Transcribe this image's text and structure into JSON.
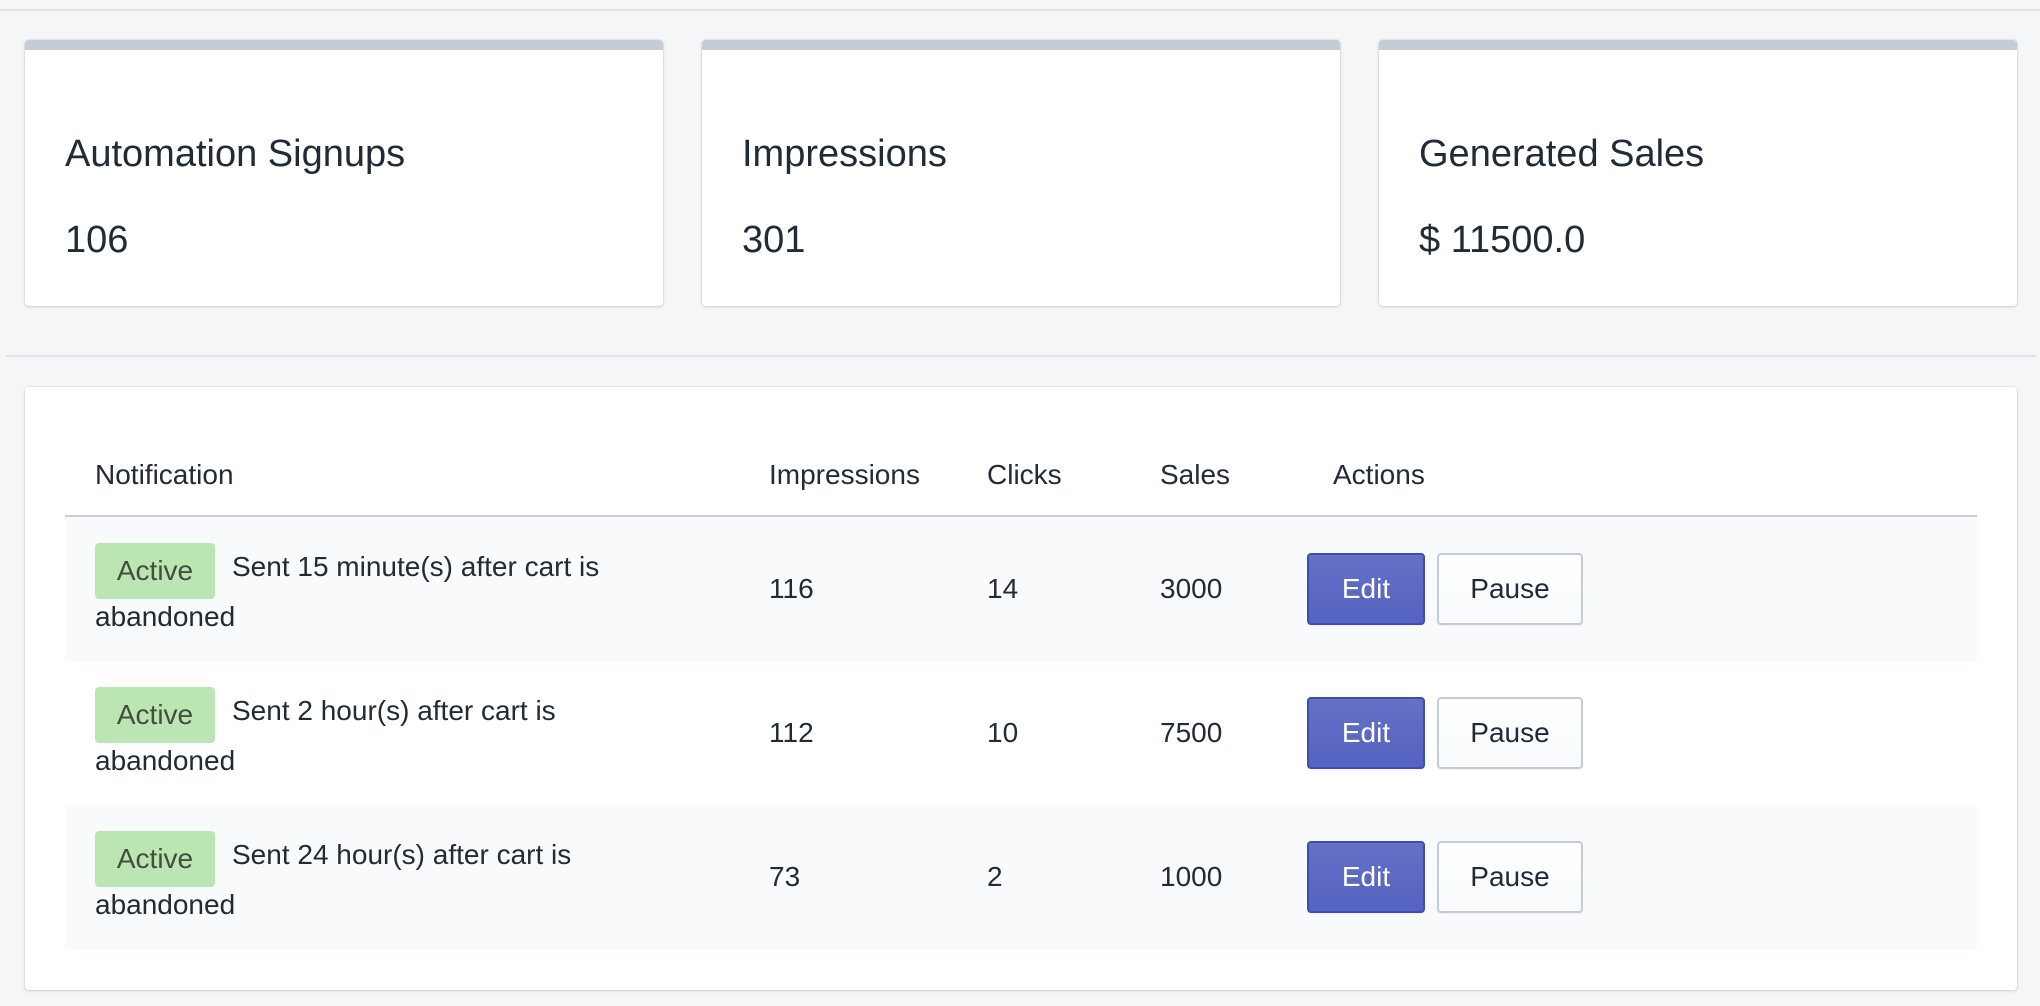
{
  "stats": [
    {
      "label": "Automation Signups",
      "value": "106"
    },
    {
      "label": "Impressions",
      "value": "301"
    },
    {
      "label": "Generated Sales",
      "value": "$ 11500.0"
    }
  ],
  "table": {
    "headers": {
      "notification": "Notification",
      "impressions": "Impressions",
      "clicks": "Clicks",
      "sales": "Sales",
      "actions": "Actions"
    },
    "rows": [
      {
        "status": "Active",
        "desc_line1": "Sent 15 minute(s) after cart is",
        "desc_line2": "abandoned",
        "impressions": "116",
        "clicks": "14",
        "sales": "3000",
        "edit_label": "Edit",
        "pause_label": "Pause"
      },
      {
        "status": "Active",
        "desc_line1": "Sent 2 hour(s) after cart is",
        "desc_line2": "abandoned",
        "impressions": "112",
        "clicks": "10",
        "sales": "7500",
        "edit_label": "Edit",
        "pause_label": "Pause"
      },
      {
        "status": "Active",
        "desc_line1": "Sent 24 hour(s) after cart is",
        "desc_line2": "abandoned",
        "impressions": "73",
        "clicks": "2",
        "sales": "1000",
        "edit_label": "Edit",
        "pause_label": "Pause"
      }
    ]
  },
  "colors": {
    "page_background": "#f4f6f8",
    "card_top_bar": "#c4cdd5",
    "active_badge": "#bbe5b3",
    "primary_button": "#5c6ac4",
    "row_alt": "#f9fafb"
  }
}
